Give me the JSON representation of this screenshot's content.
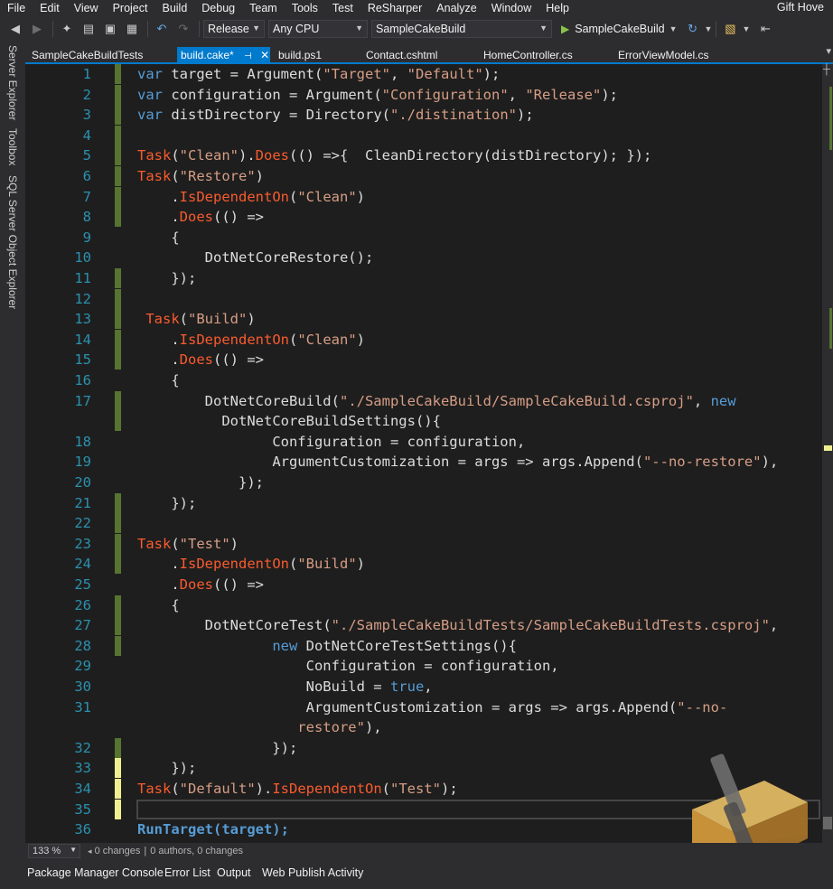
{
  "menu": {
    "items": [
      "File",
      "Edit",
      "View",
      "Project",
      "Build",
      "Debug",
      "Team",
      "Tools",
      "Test",
      "ReSharper",
      "Analyze",
      "Window",
      "Help"
    ],
    "user": "Gift Hove"
  },
  "toolbar": {
    "configuration": "Release",
    "platform": "Any CPU",
    "startup_project": "SampleCakeBuild",
    "run_target": "SampleCakeBuild"
  },
  "side_tabs": [
    "Server Explorer",
    "Toolbox",
    "SQL Server Object Explorer"
  ],
  "doc_tabs": [
    {
      "label": "SampleCakeBuildTests",
      "active": false
    },
    {
      "label": "build.cake*",
      "active": true
    },
    {
      "label": "build.ps1",
      "active": false
    },
    {
      "label": "Contact.cshtml",
      "active": false
    },
    {
      "label": "HomeController.cs",
      "active": false
    },
    {
      "label": "ErrorViewModel.cs",
      "active": false
    }
  ],
  "code_lines": [
    {
      "num": "1",
      "change": "green",
      "text": "var target = Argument(\"Target\", \"Default\");"
    },
    {
      "num": "2",
      "change": "green",
      "text": "var configuration = Argument(\"Configuration\", \"Release\");"
    },
    {
      "num": "3",
      "change": "green",
      "text": "var distDirectory = Directory(\"./distination\");"
    },
    {
      "num": "4",
      "change": "green",
      "text": ""
    },
    {
      "num": "5",
      "change": "green",
      "text": "Task(\"Clean\").Does(() =>{  CleanDirectory(distDirectory); });"
    },
    {
      "num": "6",
      "change": "green",
      "text": "Task(\"Restore\")"
    },
    {
      "num": "7",
      "change": "green",
      "text": "    .IsDependentOn(\"Clean\")"
    },
    {
      "num": "8",
      "change": "green",
      "text": "    .Does(() =>"
    },
    {
      "num": "9",
      "change": "none",
      "text": "    {"
    },
    {
      "num": "10",
      "change": "none",
      "text": "        DotNetCoreRestore();"
    },
    {
      "num": "11",
      "change": "green",
      "text": "    });"
    },
    {
      "num": "12",
      "change": "green",
      "text": ""
    },
    {
      "num": "13",
      "change": "green",
      "text": " Task(\"Build\")"
    },
    {
      "num": "14",
      "change": "green",
      "text": "    .IsDependentOn(\"Clean\")"
    },
    {
      "num": "15",
      "change": "green",
      "text": "    .Does(() =>"
    },
    {
      "num": "16",
      "change": "none",
      "text": "    {"
    },
    {
      "num": "17",
      "change": "green",
      "text": "        DotNetCoreBuild(\"./SampleCakeBuild/SampleCakeBuild.csproj\", new"
    },
    {
      "num": "",
      "change": "green",
      "text": "          DotNetCoreBuildSettings(){"
    },
    {
      "num": "18",
      "change": "none",
      "text": "                Configuration = configuration,"
    },
    {
      "num": "19",
      "change": "none",
      "text": "                ArgumentCustomization = args => args.Append(\"--no-restore\"),"
    },
    {
      "num": "20",
      "change": "none",
      "text": "            });"
    },
    {
      "num": "21",
      "change": "green",
      "text": "    });"
    },
    {
      "num": "22",
      "change": "green",
      "text": ""
    },
    {
      "num": "23",
      "change": "green",
      "text": "Task(\"Test\")"
    },
    {
      "num": "24",
      "change": "green",
      "text": "    .IsDependentOn(\"Build\")"
    },
    {
      "num": "25",
      "change": "none",
      "text": "    .Does(() =>"
    },
    {
      "num": "26",
      "change": "green",
      "text": "    {"
    },
    {
      "num": "27",
      "change": "green",
      "text": "        DotNetCoreTest(\"./SampleCakeBuildTests/SampleCakeBuildTests.csproj\","
    },
    {
      "num": "28",
      "change": "green",
      "text": "                new DotNetCoreTestSettings(){"
    },
    {
      "num": "29",
      "change": "none",
      "text": "                    Configuration = configuration,"
    },
    {
      "num": "30",
      "change": "none",
      "text": "                    NoBuild = true,"
    },
    {
      "num": "31",
      "change": "none",
      "text": "                    ArgumentCustomization = args => args.Append(\"--no-"
    },
    {
      "num": "",
      "change": "none",
      "text": "                   restore\"),"
    },
    {
      "num": "32",
      "change": "green",
      "text": "                });"
    },
    {
      "num": "33",
      "change": "yellow",
      "text": "    });"
    },
    {
      "num": "34",
      "change": "yellow",
      "text": "Task(\"Default\").IsDependentOn(\"Test\");"
    },
    {
      "num": "35",
      "change": "yellow",
      "text": ""
    },
    {
      "num": "36",
      "change": "none",
      "text": "RunTarget(target);"
    }
  ],
  "editor_status": {
    "zoom": "133 %",
    "changes": "0 changes",
    "authors": "0 authors, 0 changes"
  },
  "bottom_tabs": [
    "Package Manager Console",
    "Error List",
    "Output",
    "Web Publish Activity"
  ],
  "colors": {
    "keyword": "#569cd6",
    "string": "#d69d85",
    "method": "#f95b2e",
    "line_number": "#2b91af",
    "change_green": "#577430",
    "change_yellow": "#efef91",
    "accent": "#007acc"
  }
}
